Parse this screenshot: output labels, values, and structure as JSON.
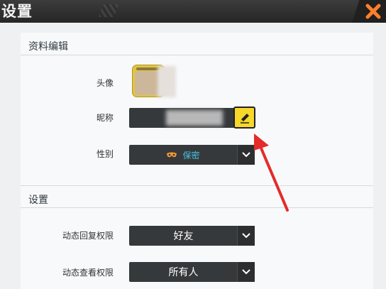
{
  "window": {
    "title": "设置"
  },
  "profile_section": {
    "title": "资料编辑",
    "avatar_label": "头像",
    "nickname_label": "昵称",
    "gender_label": "性别",
    "gender_value": "保密"
  },
  "settings_section": {
    "title": "设置",
    "reply_permission_label": "动态回复权限",
    "reply_permission_value": "好友",
    "view_permission_label": "动态查看权限",
    "view_permission_value": "所有人"
  },
  "colors": {
    "accent_yellow": "#f7d72a",
    "close_orange": "#ff7f2a",
    "gender_blue": "#47c6e0",
    "annotation_red": "#e52b2b"
  },
  "icons": [
    "close-icon",
    "pencil-icon",
    "mask-icon",
    "chevron-down-icon"
  ]
}
